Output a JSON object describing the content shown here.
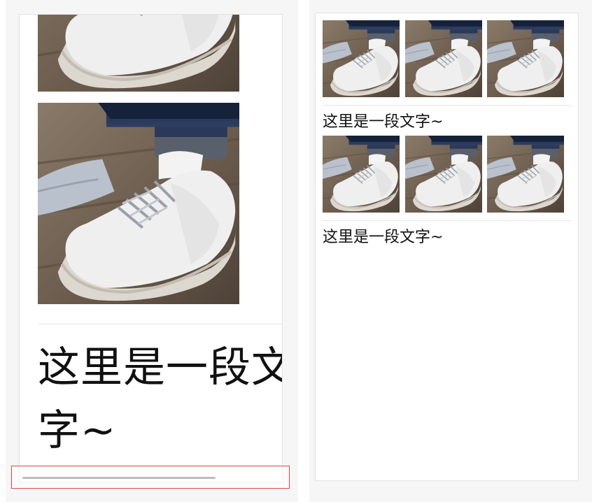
{
  "left_panel": {
    "text_line_1": "这里是一段文",
    "text_line_2": "字~",
    "image_alt": "white canvas sneaker"
  },
  "right_panel": {
    "items": [
      {
        "caption": "这里是一段文字~",
        "thumb_count": 3
      },
      {
        "caption": "这里是一段文字~",
        "thumb_count": 3
      }
    ]
  },
  "colors": {
    "highlight_border": "#e04545",
    "divider": "#e6e6e6",
    "scrollbar": "#bdbdbd"
  }
}
